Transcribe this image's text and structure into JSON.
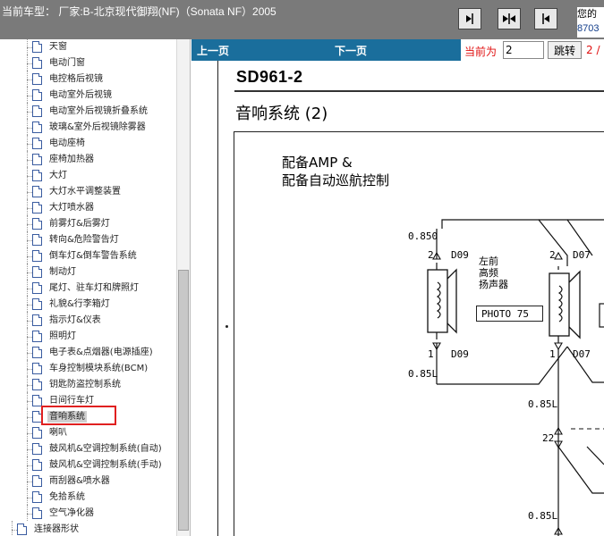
{
  "header": {
    "car_info": "当前车型：  厂家:B-北京现代御翔(NF)（Sonata NF）2005",
    "buttons": [
      {
        "name": "prev-frame",
        "icon": "arrow-into-bar-icon"
      },
      {
        "name": "fit",
        "icon": "double-arrow-icon"
      },
      {
        "name": "next-frame",
        "icon": "arrow-out-bar-icon"
      }
    ],
    "notice_line1": "您的",
    "notice_line2": "8703"
  },
  "sidebar": {
    "items": [
      {
        "label": "天窗"
      },
      {
        "label": "电动门窗"
      },
      {
        "label": "电控格后视镜"
      },
      {
        "label": "电动室外后视镜"
      },
      {
        "label": "电动室外后视镜折叠系统"
      },
      {
        "label": "玻璃&室外后视镜除雾器"
      },
      {
        "label": "电动座椅"
      },
      {
        "label": "座椅加热器"
      },
      {
        "label": "大灯"
      },
      {
        "label": "大灯水平调整装置"
      },
      {
        "label": "大灯喷水器"
      },
      {
        "label": "前雾灯&后雾灯"
      },
      {
        "label": "转向&危险警告灯"
      },
      {
        "label": "倒车灯&倒车警告系统"
      },
      {
        "label": "制动灯"
      },
      {
        "label": "尾灯、驻车灯和牌照灯"
      },
      {
        "label": "礼貌&行李箱灯"
      },
      {
        "label": "指示灯&仪表"
      },
      {
        "label": "照明灯"
      },
      {
        "label": "电子表&点烟器(电源插座)"
      },
      {
        "label": "车身控制模块系统(BCM)"
      },
      {
        "label": "钥匙防盗控制系统"
      },
      {
        "label": "日间行车灯"
      },
      {
        "label": "音响系统",
        "selected": true
      },
      {
        "label": "喇叭"
      },
      {
        "label": "鼓风机&空调控制系统(自动)"
      },
      {
        "label": "鼓风机&空调控制系统(手动)"
      },
      {
        "label": "雨刮器&喷水器"
      },
      {
        "label": "免拾系统"
      },
      {
        "label": "空气净化器"
      },
      {
        "label": "连接器形状"
      }
    ]
  },
  "toolbar": {
    "prev_label": "上一页",
    "next_label": "下一页",
    "current_label": "当前为",
    "page_value": "2",
    "jump_label": "跳转",
    "total_label": "2 /"
  },
  "document": {
    "sheet_code": "SD961-2",
    "sheet_title": "音响系统 (2)",
    "caption_line1": "配备AMP &",
    "caption_line2": "配备自动巡航控制",
    "wire_labels": [
      "0.850",
      "2",
      "D09",
      "1",
      "D09",
      "0.85L",
      "2",
      "D07",
      "1",
      "D07",
      "0.85L",
      "22",
      "0.85L"
    ],
    "left_speaker_label": [
      "左前",
      "高频",
      "扬声器"
    ],
    "photo_ref": "PHOTO 75"
  },
  "colors": {
    "header_bg": "#7a7a7a",
    "toolbar_bg": "#1a6e9c",
    "highlight": "#e02020",
    "page_counter": "#e01010"
  }
}
